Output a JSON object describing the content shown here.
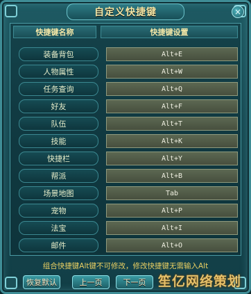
{
  "window": {
    "title": "自定义快捷键",
    "close_glyph": "×"
  },
  "header": {
    "name_col": "快捷键名称",
    "setting_col": "快捷键设置"
  },
  "rows": [
    {
      "name": "装备背包",
      "key": "Alt+E"
    },
    {
      "name": "人物属性",
      "key": "Alt+W"
    },
    {
      "name": "任务查询",
      "key": "Alt+Q"
    },
    {
      "name": "好友",
      "key": "Alt+F"
    },
    {
      "name": "队伍",
      "key": "Alt+T"
    },
    {
      "name": "技能",
      "key": "Alt+K"
    },
    {
      "name": "快捷栏",
      "key": "Alt+Y"
    },
    {
      "name": "帮派",
      "key": "Alt+B"
    },
    {
      "name": "场景地图",
      "key": "Tab"
    },
    {
      "name": "宠物",
      "key": "Alt+P"
    },
    {
      "name": "法宝",
      "key": "Alt+I"
    },
    {
      "name": "邮件",
      "key": "Alt+O"
    }
  ],
  "notice": "组合快捷键Alt键不可修改，修改快捷键无需输入Alt",
  "buttons": {
    "restore": "恢复默认",
    "prev": "上一页",
    "next": "下一页"
  },
  "watermark": "笙亿网络策划"
}
